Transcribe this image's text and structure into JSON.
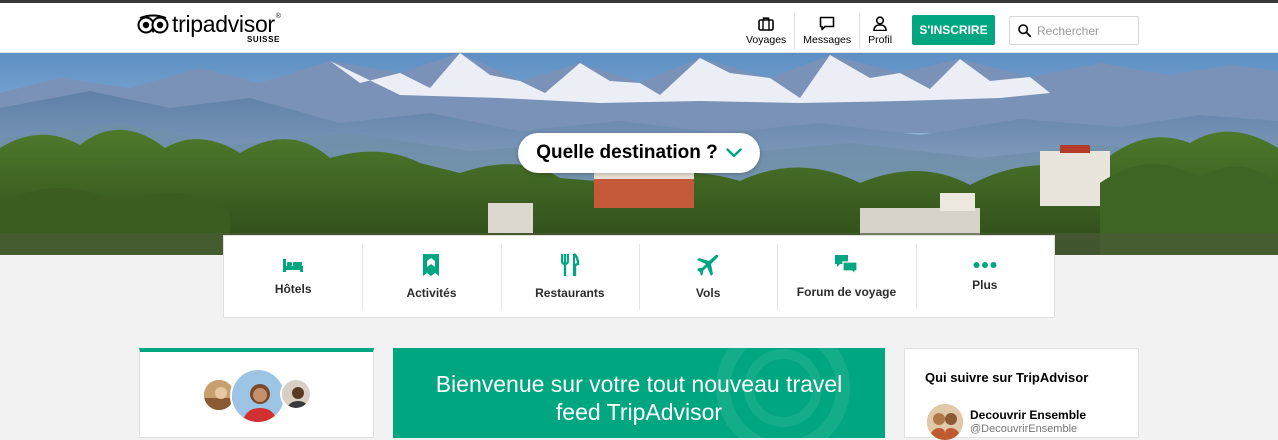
{
  "brand": {
    "name": "tripadvisor",
    "region": "SUISSE",
    "accent_color": "#00a680"
  },
  "nav": {
    "items": [
      {
        "label": "Voyages",
        "icon": "suitcase-icon"
      },
      {
        "label": "Messages",
        "icon": "chat-bubble-icon"
      },
      {
        "label": "Profil",
        "icon": "person-icon"
      }
    ],
    "signup_label": "S'INSCRIRE"
  },
  "search": {
    "placeholder": "Rechercher",
    "icon": "search-icon"
  },
  "hero": {
    "destination_prompt": "Quelle destination ?",
    "scene": "mountain-village-photo"
  },
  "categories": [
    {
      "label": "Hôtels",
      "icon": "bed-icon"
    },
    {
      "label": "Activités",
      "icon": "ticket-icon"
    },
    {
      "label": "Restaurants",
      "icon": "fork-knife-icon"
    },
    {
      "label": "Vols",
      "icon": "airplane-icon"
    },
    {
      "label": "Forum de voyage",
      "icon": "forum-icon"
    },
    {
      "label": "Plus",
      "icon": "more-dots-icon"
    }
  ],
  "feed": {
    "welcome_line1": "Bienvenue sur votre tout nouveau travel",
    "welcome_line2": "feed TripAdvisor"
  },
  "suggestions": {
    "title": "Qui suivre sur TripAdvisor",
    "users": [
      {
        "name": "Decouvrir Ensemble",
        "handle": "@DecouvrirEnsemble"
      }
    ]
  }
}
